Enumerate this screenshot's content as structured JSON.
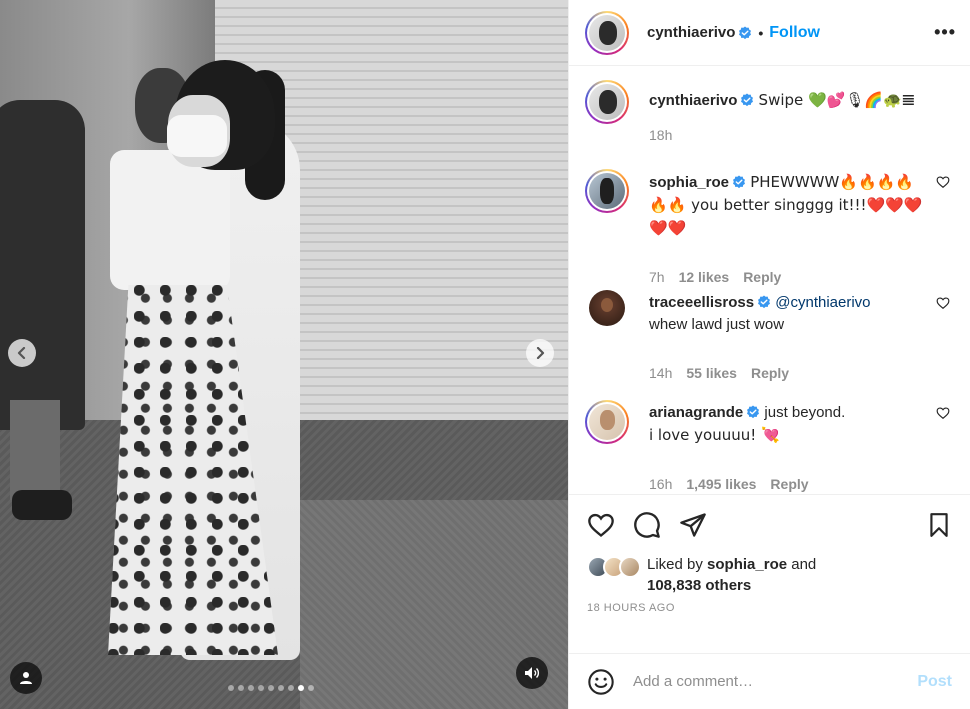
{
  "header": {
    "username": "cynthiaerivo",
    "separator": "•",
    "follow_label": "Follow",
    "more_label": "•••"
  },
  "caption": {
    "username": "cynthiaerivo",
    "text": "Swipe 💚💕🎙🌈🐢𝌆",
    "time": "18h"
  },
  "comments": [
    {
      "username": "sophia_roe",
      "text": "PHEWWWW🔥🔥🔥🔥🔥🔥 you better singggg it!!!❤️❤️❤️❤️❤️",
      "time": "7h",
      "likes": "12 likes",
      "reply_label": "Reply"
    },
    {
      "username": "traceeellisross",
      "mention": "@cynthiaerivo",
      "text": "whew lawd just wow",
      "time": "14h",
      "likes": "55 likes",
      "reply_label": "Reply"
    },
    {
      "username": "arianagrande",
      "text_line1": "just beyond.",
      "text_line2": "i love youuuu! 💘",
      "time": "16h",
      "likes": "1,495 likes",
      "reply_label": "Reply"
    }
  ],
  "likes": {
    "prefix": "Liked by ",
    "user": "sophia_roe",
    "and": " and",
    "others": "108,838 others"
  },
  "timestamp": "18 HOURS AGO",
  "add_comment": {
    "placeholder": "Add a comment…",
    "post_label": "Post"
  },
  "media": {
    "slide_count": 9,
    "active_slide": 8
  },
  "colors": {
    "accent": "#0095f6",
    "post_disabled": "#b2dffc",
    "muted": "#8e8e8e",
    "verified": "#3897f0"
  },
  "icons": [
    "chevron-left-icon",
    "chevron-right-icon",
    "user-tag-icon",
    "volume-icon",
    "verified-icon",
    "heart-icon",
    "comment-icon",
    "share-icon",
    "bookmark-icon",
    "emoji-icon"
  ]
}
